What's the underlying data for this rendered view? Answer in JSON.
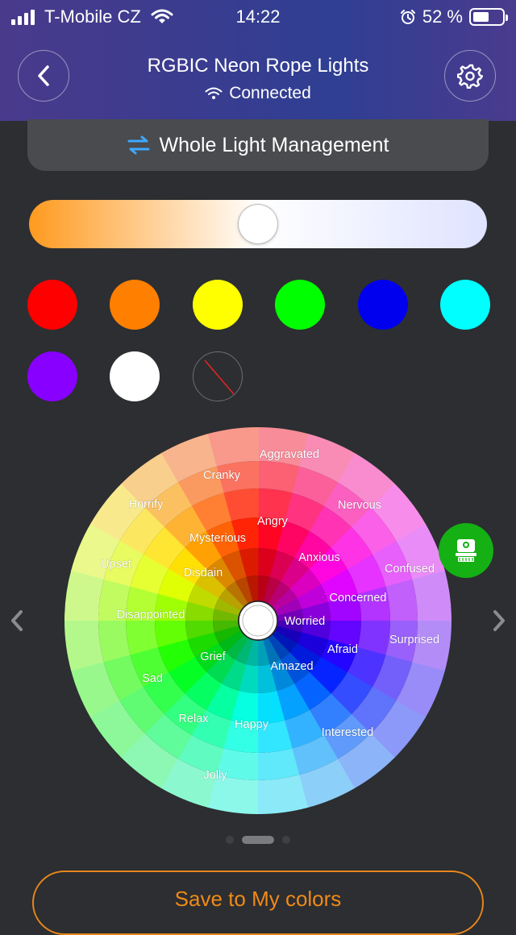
{
  "status_bar": {
    "carrier": "T-Mobile CZ",
    "time": "14:22",
    "battery": "52 %",
    "battery_level": 0.52
  },
  "header": {
    "title": "RGBIC Neon Rope Lights",
    "status": "Connected"
  },
  "management": {
    "label": "Whole Light Management"
  },
  "color_temp_slider": {
    "value": 0.5,
    "colors": {
      "warm": "#ff9a1f",
      "mid": "#ffffff",
      "cool": "#dfe3ff"
    }
  },
  "swatches": [
    {
      "name": "red",
      "color": "#ff0000"
    },
    {
      "name": "orange",
      "color": "#ff7f00"
    },
    {
      "name": "yellow",
      "color": "#ffff00"
    },
    {
      "name": "green",
      "color": "#00ff00"
    },
    {
      "name": "blue",
      "color": "#0000ee"
    },
    {
      "name": "cyan",
      "color": "#00ffff"
    },
    {
      "name": "purple",
      "color": "#8800ff"
    },
    {
      "name": "white",
      "color": "#ffffff"
    },
    {
      "name": "none",
      "color": "none"
    }
  ],
  "mood_wheel": {
    "labels": {
      "aggravated": "Aggravated",
      "cranky": "Cranky",
      "nervous": "Nervous",
      "horrify": "Horrify",
      "angry": "Angry",
      "mysterious": "Mysterious",
      "anxious": "Anxious",
      "upset": "Upset",
      "disdain": "Disdain",
      "confused": "Confused",
      "concerned": "Concerned",
      "disappointed": "Disappointed",
      "worried": "Worried",
      "surprised": "Surprised",
      "afraid": "Afraid",
      "grief": "Grief",
      "amazed": "Amazed",
      "sad": "Sad",
      "relax": "Relax",
      "happy": "Happy",
      "interested": "Interested",
      "jolly": "Jolly"
    }
  },
  "pager": {
    "count": 3,
    "active": 1
  },
  "save_button": {
    "label": "Save to My colors"
  },
  "colors": {
    "accent": "#f08a16",
    "scene_button": "#14b014",
    "background": "#2c2e31"
  }
}
